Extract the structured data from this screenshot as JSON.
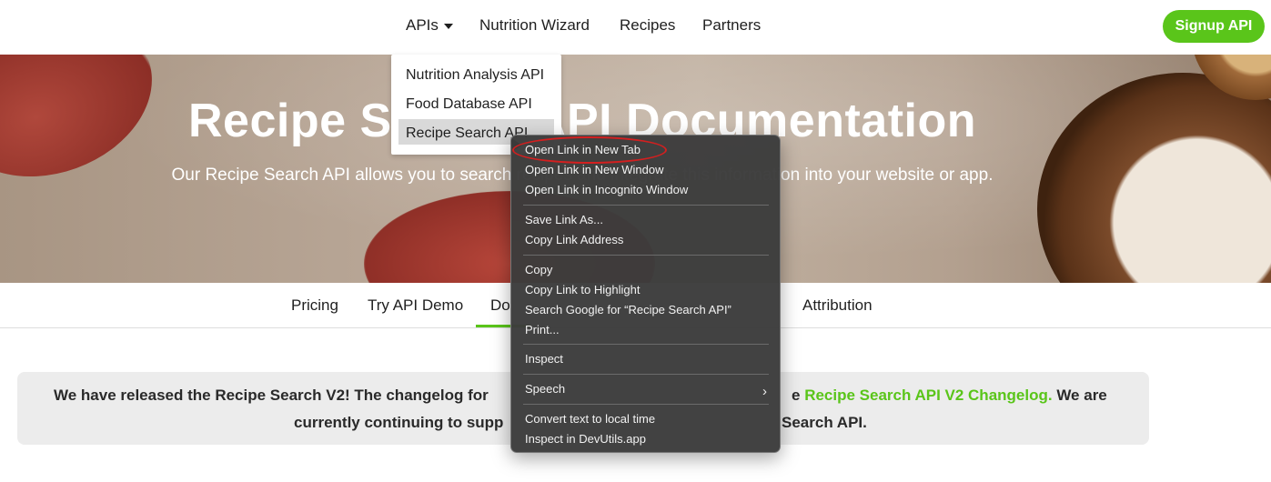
{
  "topnav": {
    "apis_label": "APIs",
    "wizard_label": "Nutrition Wizard",
    "recipes_label": "Recipes",
    "partners_label": "Partners",
    "signup_label": "Signup API"
  },
  "hero": {
    "title": "Recipe Search API Documentation",
    "subtitle": "Our Recipe Search API allows you to search recipes and integrate this information into your website or app."
  },
  "apis_dropdown": {
    "items": [
      "Nutrition Analysis API",
      "Food Database API",
      "Recipe Search API"
    ]
  },
  "subnav": {
    "pricing": "Pricing",
    "demo": "Try API Demo",
    "docs": "Do",
    "attribution": "Attribution"
  },
  "notice": {
    "line1_start": "We have released the Recipe Search V2! The changelog for",
    "line1_prefix": "e ",
    "link_text": "Recipe Search API V2 Changelog.",
    "line1_end": " We are",
    "line2_start": "currently continuing to supp",
    "line2_end": "Search API."
  },
  "context_menu": {
    "items": [
      "Open Link in New Tab",
      "Open Link in New Window",
      "Open Link in Incognito Window",
      "Save Link As...",
      "Copy Link Address",
      "Copy",
      "Copy Link to Highlight",
      "Search Google for “Recipe Search API”",
      "Print...",
      "Inspect",
      "Speech",
      "Convert text to local time",
      "Inspect in DevUtils.app"
    ]
  },
  "colors": {
    "accent_green": "#5ac51a",
    "highlight_red": "#d41f1f"
  }
}
